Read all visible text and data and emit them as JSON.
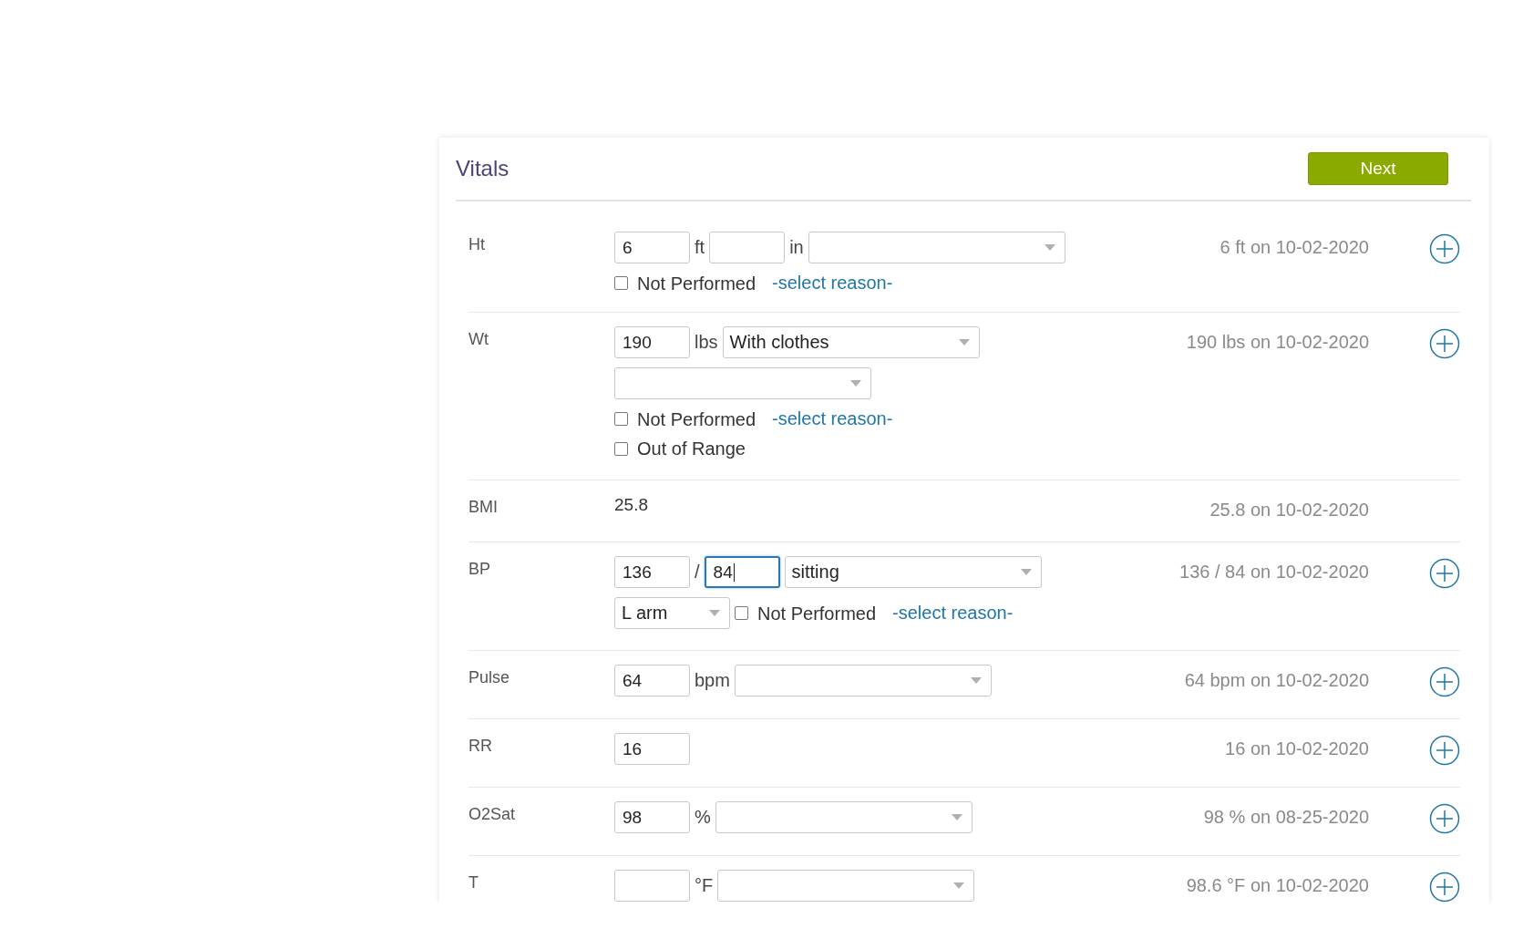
{
  "panel": {
    "title": "Vitals",
    "next_button": "Next"
  },
  "vitals": [
    {
      "label": "Ht",
      "history": "6 ft on 10-02-2020",
      "add_button": true,
      "lines": [
        [
          {
            "kind": "input",
            "value": "6",
            "focused": false
          },
          {
            "kind": "unit",
            "text": "ft"
          },
          {
            "kind": "input",
            "focused": false
          },
          {
            "kind": "unit",
            "text": "in"
          },
          {
            "kind": "select"
          }
        ],
        [
          {
            "kind": "checkbox",
            "label": "Not Performed",
            "checked": false
          },
          {
            "kind": "link",
            "text": "-select reason-"
          }
        ]
      ]
    },
    {
      "label": "Wt",
      "history": "190 lbs on 10-02-2020",
      "add_button": true,
      "lines": [
        [
          {
            "kind": "input",
            "value": "190",
            "focused": false
          },
          {
            "kind": "unit",
            "text": "lbs"
          },
          {
            "kind": "select",
            "value": "With clothes"
          }
        ],
        [
          {
            "kind": "select"
          }
        ],
        [
          {
            "kind": "checkbox",
            "label": "Not Performed",
            "checked": false
          },
          {
            "kind": "link",
            "text": "-select reason-"
          }
        ],
        [
          {
            "kind": "checkbox",
            "label": "Out of Range",
            "checked": false
          }
        ]
      ]
    },
    {
      "label": "BMI",
      "history": "25.8 on 10-02-2020",
      "add_button": false,
      "lines": [
        [
          {
            "kind": "value",
            "text": "25.8"
          }
        ]
      ]
    },
    {
      "label": "BP",
      "history": "136 / 84 on 10-02-2020",
      "add_button": true,
      "lines": [
        [
          {
            "kind": "input",
            "value": "136",
            "focused": false
          },
          {
            "kind": "unit",
            "text": "/"
          },
          {
            "kind": "input",
            "value": "84",
            "focused": true
          },
          {
            "kind": "select",
            "value": "sitting"
          }
        ],
        [
          {
            "kind": "short_select",
            "value": "L arm"
          },
          {
            "kind": "checkbox",
            "label": "Not Performed",
            "checked": false
          },
          {
            "kind": "link",
            "text": "-select reason-"
          }
        ]
      ]
    },
    {
      "label": "Pulse",
      "history": "64 bpm on 10-02-2020",
      "add_button": true,
      "lines": [
        [
          {
            "kind": "input",
            "value": "64",
            "focused": false
          },
          {
            "kind": "unit",
            "text": "bpm"
          },
          {
            "kind": "select"
          }
        ]
      ]
    },
    {
      "label": "RR",
      "history": "16 on 10-02-2020",
      "add_button": true,
      "lines": [
        [
          {
            "kind": "input",
            "value": "16",
            "focused": false
          }
        ]
      ]
    },
    {
      "label": "O2Sat",
      "history": "98 % on 08-25-2020",
      "add_button": true,
      "lines": [
        [
          {
            "kind": "input",
            "value": "98",
            "focused": false
          },
          {
            "kind": "unit",
            "text": "%"
          },
          {
            "kind": "select"
          }
        ]
      ]
    },
    {
      "label": "T",
      "history": "98.6 °F on 10-02-2020",
      "add_button": true,
      "lines": [
        [
          {
            "kind": "input",
            "focused": false
          },
          {
            "kind": "unit",
            "text": "°F"
          },
          {
            "kind": "select"
          }
        ]
      ]
    }
  ]
}
